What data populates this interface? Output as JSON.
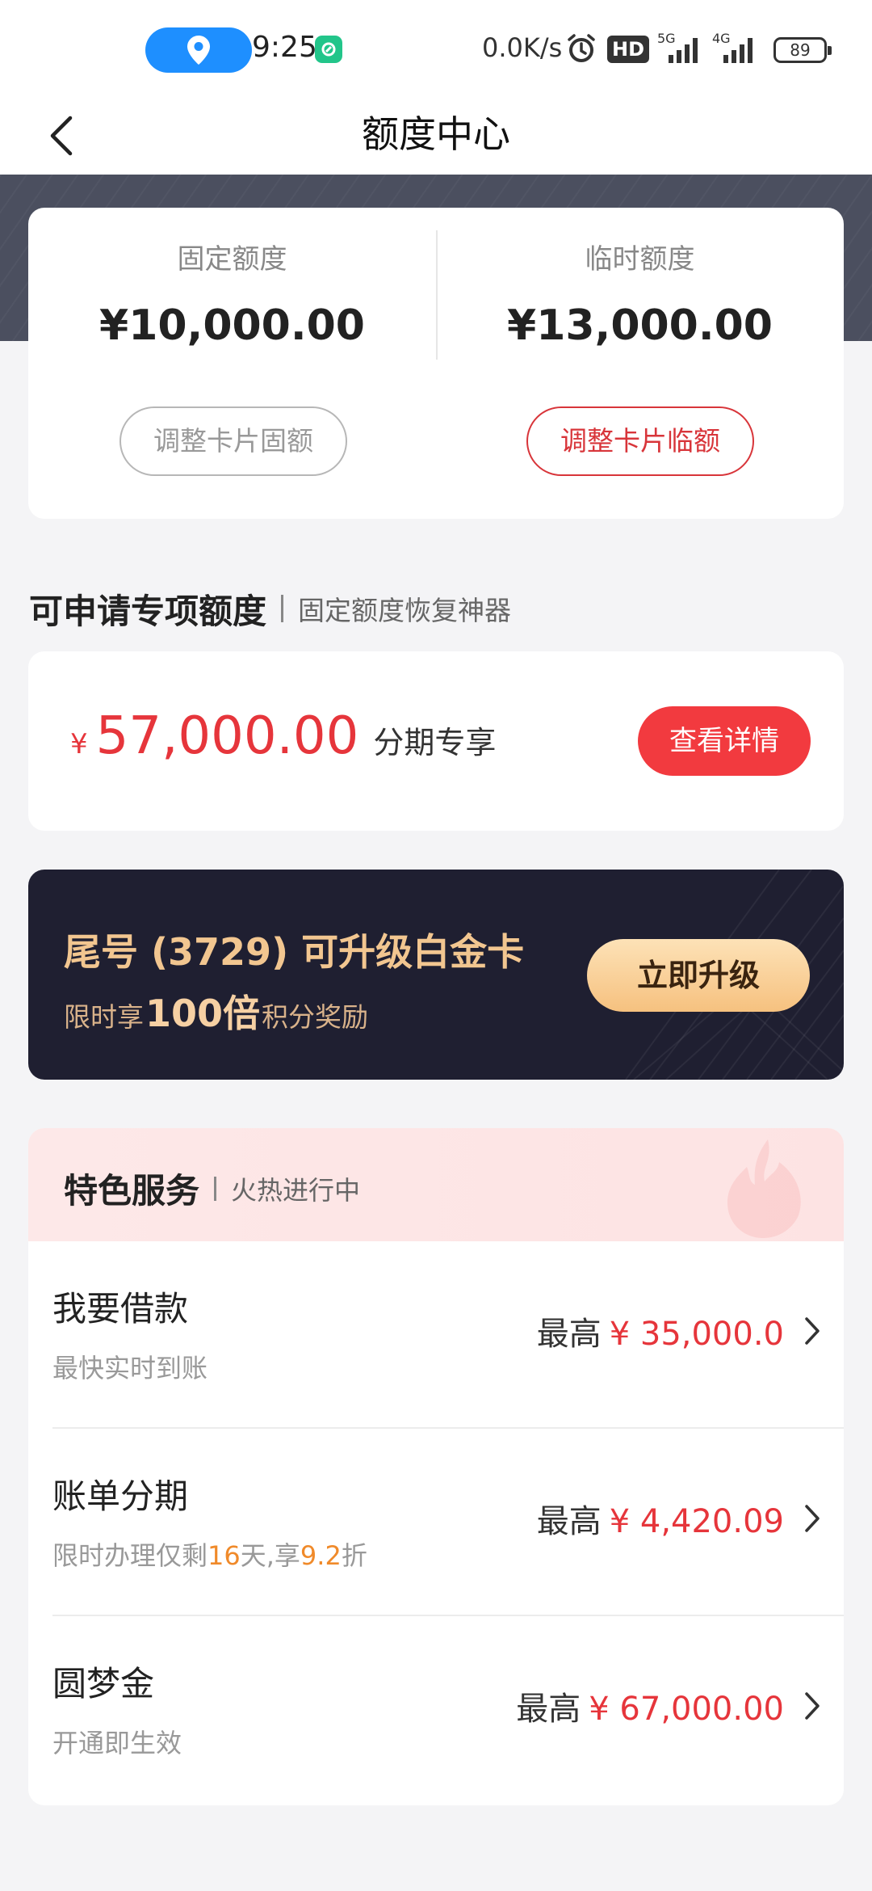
{
  "status_bar": {
    "time": "9:25",
    "net_speed": "0.0K/s",
    "hd_label": "HD",
    "signal1_label": "5G",
    "signal2_label": "4G",
    "battery": "89",
    "icons": [
      "location-icon",
      "app-icon",
      "alarm-icon",
      "signal-icon",
      "battery-icon"
    ]
  },
  "nav": {
    "title": "额度中心",
    "back_icon": "chevron-left-icon"
  },
  "quota": {
    "fixed_label": "固定额度",
    "fixed_amount": "¥10,000.00",
    "temp_label": "临时额度",
    "temp_amount": "¥13,000.00",
    "adjust_fixed_btn": "调整卡片固额",
    "adjust_temp_btn": "调整卡片临额"
  },
  "special": {
    "title": "可申请专项额度",
    "subtitle": "固定额度恢复神器",
    "currency": "¥",
    "amount": "57,000.00",
    "desc": "分期专享",
    "detail_btn": "查看详情"
  },
  "upgrade": {
    "title": "尾号 (3729) 可升级白金卡",
    "sub_prefix": "限时享",
    "sub_big": "100倍",
    "sub_suffix": "积分奖励",
    "button": "立即升级"
  },
  "services": {
    "title": "特色服务",
    "subtitle": "火热进行中",
    "items": [
      {
        "name": "我要借款",
        "desc": "最快实时到账",
        "max_label": "最高",
        "amount": "¥ 35,000.0"
      },
      {
        "name": "账单分期",
        "desc_parts": [
          "限时办理仅剩",
          "16",
          "天,享",
          "9.2",
          "折"
        ],
        "max_label": "最高",
        "amount": "¥ 4,420.09"
      },
      {
        "name": "圆梦金",
        "desc": "开通即生效",
        "max_label": "最高",
        "amount": "¥ 67,000.00"
      }
    ]
  },
  "colors": {
    "accent_red": "#e6353b",
    "dark_banner": "#1f1f31",
    "gold": "#f2c690",
    "highlight_orange": "#f08a2a"
  }
}
